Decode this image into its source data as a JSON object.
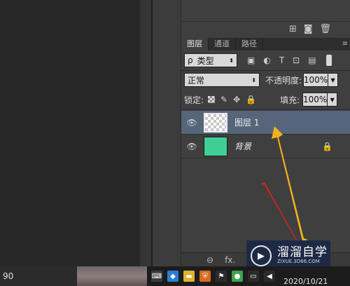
{
  "toolbar": {
    "icons": [
      "new-folder-icon",
      "camera-icon",
      "trash-icon"
    ]
  },
  "tabs": [
    {
      "label": "图层"
    },
    {
      "label": "通道"
    },
    {
      "label": "路径"
    }
  ],
  "filter": {
    "search_glyph": "ρ",
    "kind_label": "类型"
  },
  "blend": {
    "mode": "正常",
    "opacity_label": "不透明度:",
    "opacity_value": "100%"
  },
  "lock": {
    "label": "锁定:",
    "fill_label": "填充:",
    "fill_value": "100%"
  },
  "layers": [
    {
      "name": "图层 1",
      "selected": true,
      "thumbnail": "transparent"
    },
    {
      "name": "背景",
      "selected": false,
      "thumbnail": "green",
      "locked": true
    }
  ],
  "bottom_bar": {
    "fx_label": "fx."
  },
  "watermark": {
    "title": "溜溜自学",
    "url": "ZIXUE.3D66.COM"
  },
  "taskbar": {
    "left_text": "90",
    "clock": "2020/10/21"
  },
  "colors": {
    "layer_thumb_green": "#3fcf96",
    "selected_layer_bg": "#56657a",
    "arrow_yellow": "#f2b01e",
    "arrow_red": "#e02020"
  }
}
